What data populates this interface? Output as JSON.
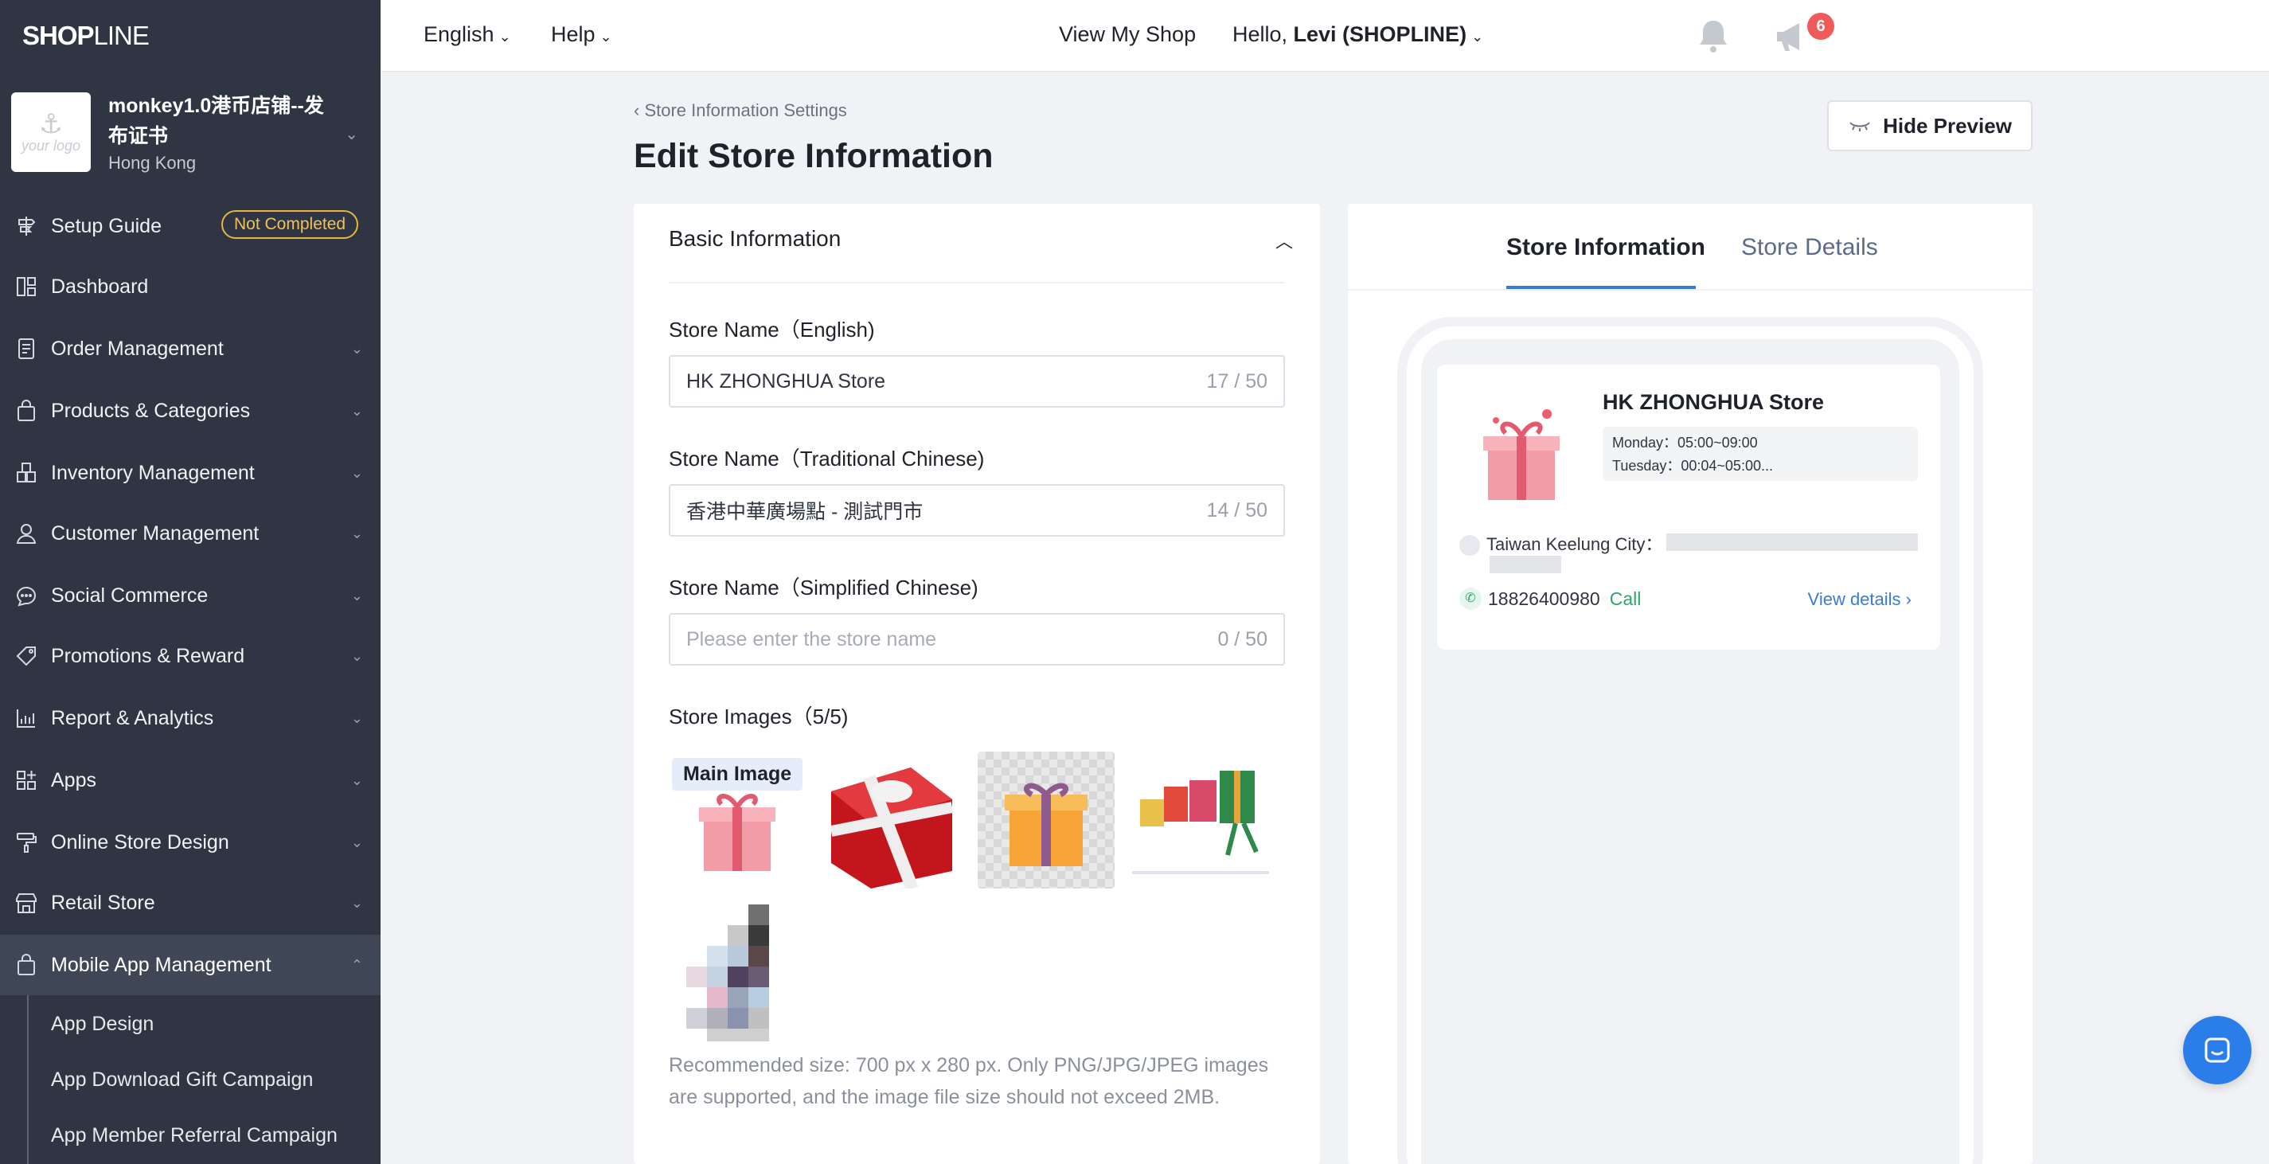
{
  "brand": {
    "logo_text_a": "SHOP",
    "logo_text_b": "LINE"
  },
  "store": {
    "name": "monkey1.0港币店铺--发布证书",
    "region": "Hong Kong",
    "logo_placeholder": "your logo"
  },
  "sidebar": {
    "items": [
      {
        "label": "Setup Guide",
        "badge": "Not Completed"
      },
      {
        "label": "Dashboard"
      },
      {
        "label": "Order Management"
      },
      {
        "label": "Products & Categories"
      },
      {
        "label": "Inventory Management"
      },
      {
        "label": "Customer Management"
      },
      {
        "label": "Social Commerce"
      },
      {
        "label": "Promotions & Reward"
      },
      {
        "label": "Report & Analytics"
      },
      {
        "label": "Apps"
      },
      {
        "label": "Online Store Design"
      },
      {
        "label": "Retail Store"
      },
      {
        "label": "Mobile App Management"
      }
    ],
    "subitems": [
      {
        "label": "App Design"
      },
      {
        "label": "App Download Gift Campaign"
      },
      {
        "label": "App Member Referral Campaign"
      }
    ]
  },
  "topbar": {
    "language": "English",
    "help": "Help",
    "notification_count": "6",
    "view_shop": "View My Shop",
    "greeting": "Hello, ",
    "user": "Levi (SHOPLINE)"
  },
  "main": {
    "breadcrumb": "Store Information Settings",
    "title": "Edit Store Information",
    "hide_preview": "Hide Preview"
  },
  "form": {
    "section_title": "Basic Information",
    "fields": [
      {
        "label": "Store Name（English)",
        "value": "HK ZHONGHUA Store",
        "placeholder": "",
        "count": "17 / 50"
      },
      {
        "label": "Store Name（Traditional Chinese)",
        "value": "香港中華廣場點 - 測試門市",
        "placeholder": "",
        "count": "14 / 50"
      },
      {
        "label": "Store Name（Simplified Chinese)",
        "value": "",
        "placeholder": "Please enter the store name",
        "count": "0 / 50"
      }
    ],
    "images_label": "Store Images（5/5)",
    "main_image_tag": "Main Image",
    "hint": "Recommended size: 700 px x 280 px. Only PNG/JPG/JPEG images are supported, and the image file size should not exceed 2MB."
  },
  "preview": {
    "tabs": [
      {
        "label": "Store Information"
      },
      {
        "label": "Store Details"
      }
    ],
    "store_name": "HK ZHONGHUA Store",
    "hours": [
      "Monday：05:00~09:00",
      "Tuesday：00:04~05:00..."
    ],
    "address": "Taiwan Keelung City：",
    "phone": "18826400980",
    "call": "Call",
    "view_details": "View details"
  },
  "colors": {
    "sidebar_bg": "#2f3542",
    "accent": "#3a7bd5",
    "badge": "#e7b43d",
    "call": "#2aa66a"
  }
}
